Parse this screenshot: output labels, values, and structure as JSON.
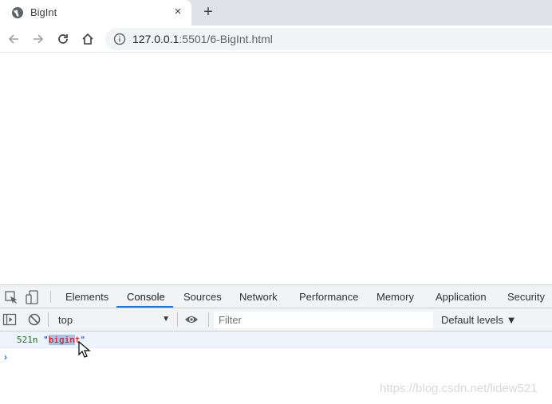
{
  "browser": {
    "tab": {
      "title": "BigInt",
      "favicon": "globe-icon",
      "close": "×"
    },
    "new_tab": "+",
    "address": {
      "host": "127.0.0.1",
      "path": ":5501/6-BigInt.html",
      "info_icon": "info-icon"
    }
  },
  "devtools": {
    "tabs": [
      {
        "label": "Elements"
      },
      {
        "label": "Console",
        "active": true
      },
      {
        "label": "Sources"
      },
      {
        "label": "Network"
      },
      {
        "label": "Performance"
      },
      {
        "label": "Memory"
      },
      {
        "label": "Application"
      },
      {
        "label": "Security"
      }
    ],
    "toolbar": {
      "context": "top",
      "filter_placeholder": "Filter",
      "levels": "Default levels ▼"
    },
    "console": {
      "message": {
        "number": "521n",
        "quote_open": "\"",
        "selected": "bigin",
        "rest": "t",
        "quote_close": "\""
      },
      "prompt": "›"
    }
  },
  "watermark": "https://blog.csdn.net/lidew521",
  "colors": {
    "accent": "#1a73e8",
    "console_number": "#1c6c0f",
    "selection": "#aac2e8"
  }
}
